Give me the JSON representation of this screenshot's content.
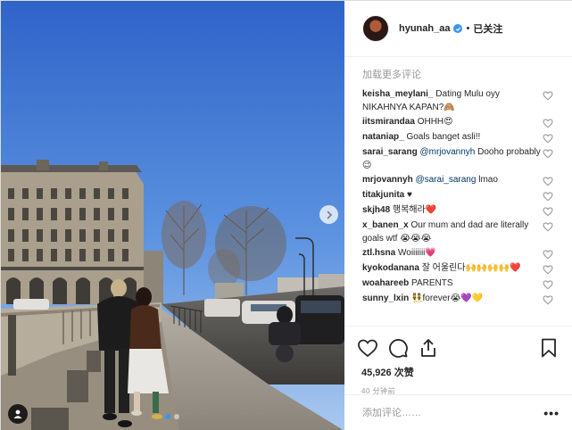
{
  "post": {
    "username": "hyunah_aa",
    "follow_separator": "•",
    "follow_label": "已关注",
    "load_more": "加载更多评论",
    "comments": [
      {
        "user": "keisha_meylani_",
        "text": "Dating Mulu oyy NIKAHNYA KAPAN?🙈"
      },
      {
        "user": "iitsmirandaa",
        "text": "OHHH😍"
      },
      {
        "user": "nataniap_",
        "text": "Goals banget asli!!"
      },
      {
        "user": "sarai_sarang",
        "mention": "@mrjovannyh",
        "text": "Dooho probably😉"
      },
      {
        "user": "mrjovannyh",
        "mention": "@sarai_sarang",
        "text": "lmao"
      },
      {
        "user": "titakjunita",
        "text": "♥"
      },
      {
        "user": "skjh48",
        "text": "행복해라❤️"
      },
      {
        "user": "x_banen_x",
        "text": "Our mum and dad are literally goals wtf 😭😭😭"
      },
      {
        "user": "ztl.hsna",
        "text": "Woiiiiiii💗"
      },
      {
        "user": "kyokodanana",
        "text": "잘 어울린다🙌🙌🙌🙌❤️"
      },
      {
        "user": "woahareeb",
        "text": "PARENTS"
      },
      {
        "user": "sunny_lxin",
        "text": "👯forever😭💜💛"
      }
    ],
    "likes": "45,926 次赞",
    "time": "40 分钟前",
    "comment_placeholder": "添加评论……",
    "more_label": "•••",
    "carousel_index": 0,
    "carousel_count": 2
  },
  "icons": {
    "heart": "heart-icon",
    "comment": "comment-icon",
    "share": "share-icon",
    "save": "bookmark-icon",
    "next": "chevron-right-icon",
    "tag": "user-tag-icon",
    "verified": "verified-badge-icon"
  },
  "colors": {
    "accent": "#3897f0",
    "muted": "#999999",
    "text": "#262626"
  }
}
